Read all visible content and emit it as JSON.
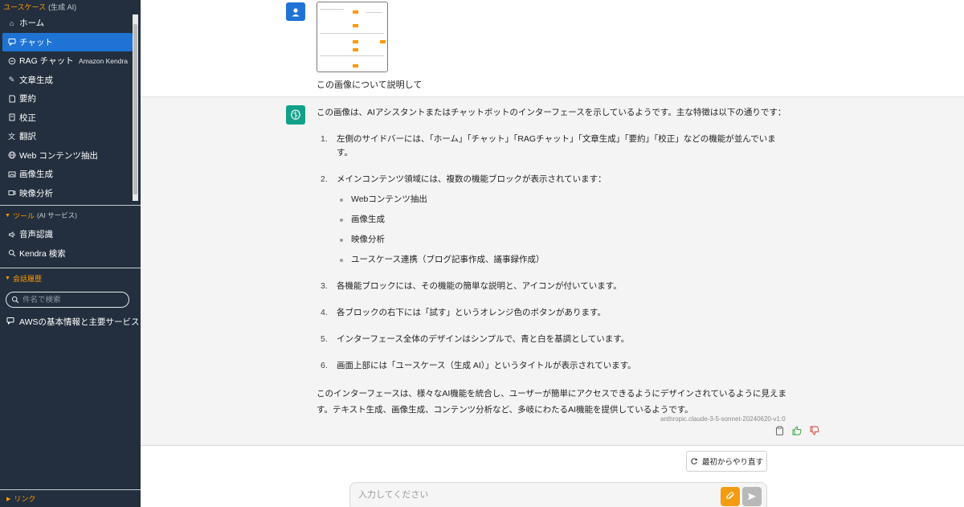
{
  "sidebar": {
    "usecase_title": "ユースケース",
    "usecase_sub": "(生成 AI)",
    "items": [
      {
        "label": "ホーム",
        "icon": "home-icon"
      },
      {
        "label": "チャット",
        "icon": "chat-icon"
      },
      {
        "label": "RAG チャット",
        "icon": "rag-chat-icon",
        "badge": "Amazon Kendra"
      },
      {
        "label": "文章生成",
        "icon": "pencil-icon"
      },
      {
        "label": "要約",
        "icon": "summary-icon"
      },
      {
        "label": "校正",
        "icon": "proofread-icon"
      },
      {
        "label": "翻訳",
        "icon": "translate-icon"
      },
      {
        "label": "Web コンテンツ抽出",
        "icon": "globe-icon"
      },
      {
        "label": "画像生成",
        "icon": "image-icon"
      },
      {
        "label": "映像分析",
        "icon": "video-icon"
      }
    ],
    "tools_title": "ツール",
    "tools_sub": "(AI サービス)",
    "tools": [
      {
        "label": "音声認識",
        "icon": "audio-icon"
      },
      {
        "label": "Kendra 検索",
        "icon": "search-icon"
      }
    ],
    "history_title": "会話履歴",
    "history_search_placeholder": "件名で検索",
    "history_items": [
      {
        "label": "AWSの基本情報と主要サービス"
      }
    ],
    "link_label": "リンク"
  },
  "chat": {
    "user_text": "この画像について説明して",
    "ai_intro": "この画像は、AIアシスタントまたはチャットボットのインターフェースを示しているようです。主な特徴は以下の通りです：",
    "ai_items": [
      {
        "num": "1.",
        "text": "左側のサイドバーには、「ホーム」「チャット」「RAGチャット」「文章生成」「要約」「校正」などの機能が並んでいます。"
      },
      {
        "num": "2.",
        "text": "メインコンテンツ領域には、複数の機能ブロックが表示されています："
      }
    ],
    "ai_bullets": [
      "Webコンテンツ抽出",
      "画像生成",
      "映像分析",
      "ユースケース連携（ブログ記事作成、議事録作成）"
    ],
    "ai_items2": [
      {
        "num": "3.",
        "text": "各機能ブロックには、その機能の簡単な説明と、アイコンが付いています。"
      },
      {
        "num": "4.",
        "text": "各ブロックの右下には「試す」というオレンジ色のボタンがあります。"
      },
      {
        "num": "5.",
        "text": "インターフェース全体のデザインはシンプルで、青と白を基調としています。"
      },
      {
        "num": "6.",
        "text": "画面上部には「ユースケース（生成 AI）」というタイトルが表示されています。"
      }
    ],
    "ai_closing": "このインターフェースは、様々なAI機能を統合し、ユーザーが簡単にアクセスできるようにデザインされているように見えます。テキスト生成、画像生成、コンテンツ分析など、多岐にわたるAI機能を提供しているようです。",
    "model_id": "anthropic.claude-3-5-sonnet-20240620-v1:0",
    "retry_label": "最初からやり直す",
    "input_placeholder": "入力してください"
  },
  "colors": {
    "sidebar_bg": "#232f3e",
    "accent_orange": "#ff9900",
    "active_blue": "#1f73d4",
    "ai_avatar": "#13a08a"
  }
}
